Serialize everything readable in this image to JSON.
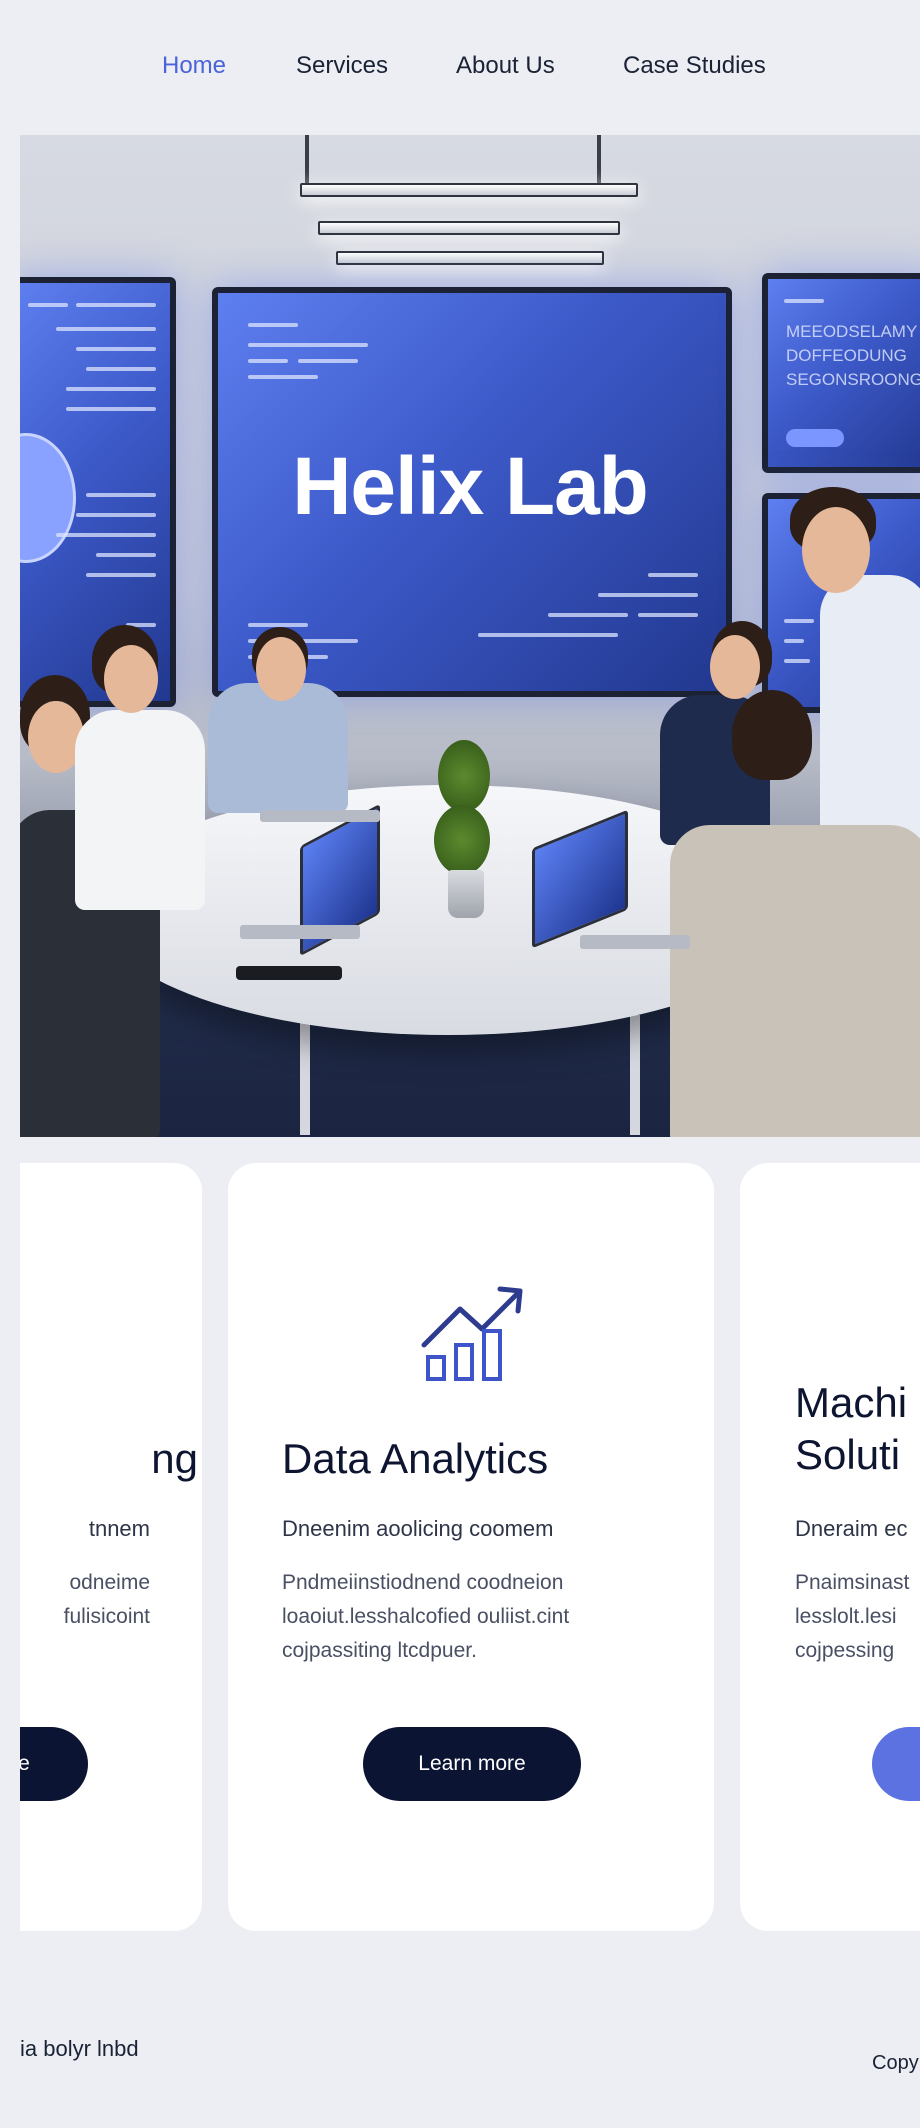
{
  "nav": {
    "items": [
      {
        "label": "Home",
        "active": true
      },
      {
        "label": "Services",
        "active": false
      },
      {
        "label": "About Us",
        "active": false
      },
      {
        "label": "Case Studies",
        "active": false
      }
    ]
  },
  "hero": {
    "title": "Helix Lab",
    "right_screen_text": [
      "MEEODSELAMY",
      "DOFFEODUNG",
      "SEGONSROONG"
    ]
  },
  "cards": [
    {
      "title_lines": [
        "ng"
      ],
      "subtitle": "tnnem",
      "body_lines": [
        "odneime",
        "fulisicoint"
      ],
      "button_label": "e"
    },
    {
      "title_lines": [
        "Data Analytics"
      ],
      "subtitle": "Dneenim aoolicing coomem",
      "body_lines": [
        "Pndmeiinstiodnend coodneion",
        "loaoiut.lesshalcofied ouliist.cint",
        "cojpassiting ltcdpuer."
      ],
      "button_label": "Learn more",
      "icon": "analytics-chart-icon"
    },
    {
      "title_lines": [
        "Machi",
        "Soluti"
      ],
      "subtitle": "Dneraim ec",
      "body_lines": [
        "Pnaimsinast",
        "lesslolt.lesi",
        "cojpessing"
      ],
      "button_label": ""
    }
  ],
  "footer": {
    "left_text": "ia bolyr lnbd",
    "right_text": "Copy"
  },
  "colors": {
    "accent": "#4a63d8",
    "dark_button": "#0b1433",
    "light_button": "#5b72e0",
    "page_bg": "#eceef3"
  }
}
